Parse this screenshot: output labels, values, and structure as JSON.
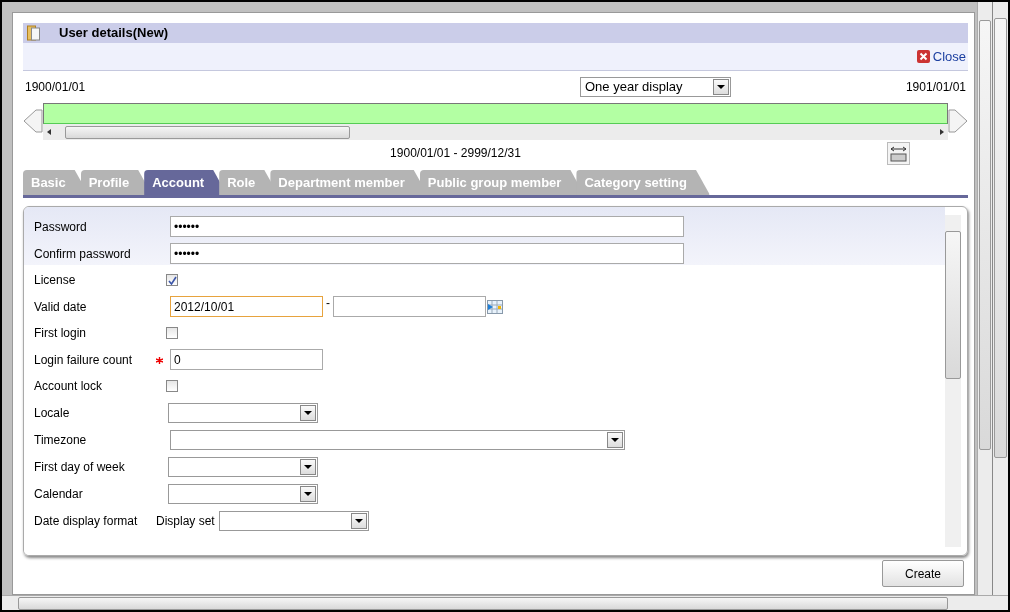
{
  "header": {
    "title": "User details(New)",
    "close_label": "Close"
  },
  "timeline": {
    "start": "1900/01/01",
    "end": "1901/01/01",
    "display_select": "One year display",
    "range": "1900/01/01 - 2999/12/31"
  },
  "tabs": [
    {
      "label": "Basic",
      "selected": false
    },
    {
      "label": "Profile",
      "selected": false
    },
    {
      "label": "Account",
      "selected": true
    },
    {
      "label": "Role",
      "selected": false
    },
    {
      "label": "Department member",
      "selected": false
    },
    {
      "label": "Public group member",
      "selected": false
    },
    {
      "label": "Category setting",
      "selected": false
    }
  ],
  "form": [
    {
      "kind": "password",
      "label": "Password",
      "value": "••••••"
    },
    {
      "kind": "password",
      "label": "Confirm password",
      "value": "••••••"
    },
    {
      "kind": "checkbox",
      "label": "License",
      "checked": true
    },
    {
      "kind": "daterange",
      "label": "Valid date",
      "value": "2012/10/01",
      "separator": "-",
      "focused": true
    },
    {
      "kind": "checkbox",
      "label": "First login",
      "checked": false
    },
    {
      "kind": "text",
      "label": "Login failure count",
      "required": true,
      "value": "0"
    },
    {
      "kind": "checkbox",
      "label": "Account lock",
      "checked": false
    },
    {
      "kind": "select",
      "label": "Locale"
    },
    {
      "kind": "wideselect",
      "label": "Timezone"
    },
    {
      "kind": "select",
      "label": "First day of week"
    },
    {
      "kind": "select",
      "label": "Calendar"
    },
    {
      "kind": "labelselect",
      "label": "Date display format",
      "sublabel": "Display set"
    }
  ],
  "buttons": [
    {
      "label": "Create"
    }
  ]
}
